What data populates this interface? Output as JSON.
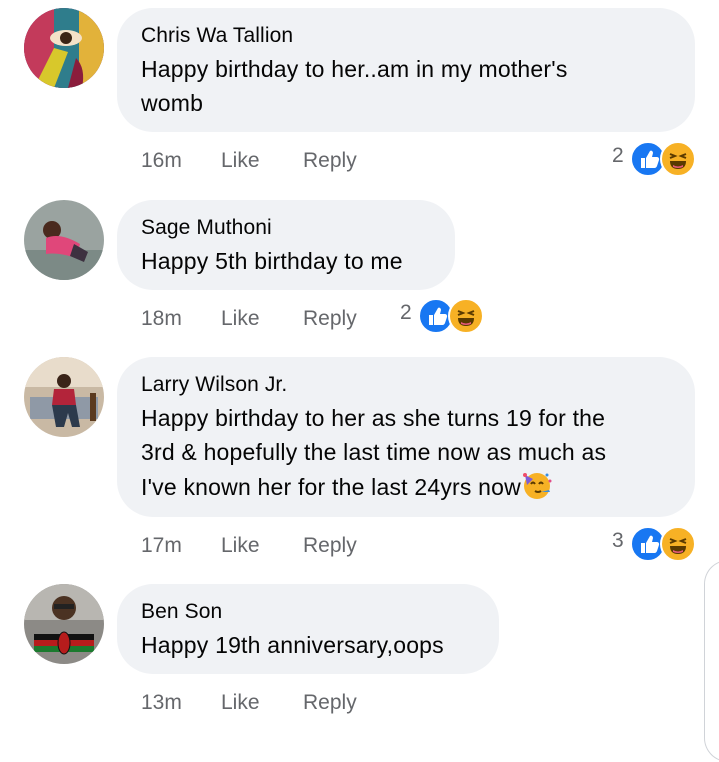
{
  "actions": {
    "like_label": "Like",
    "reply_label": "Reply"
  },
  "comments": [
    {
      "author": "Chris Wa Tallion",
      "text": "Happy birthday to her..am in my mother's womb",
      "text_lines": [
        "Happy birthday to her..am in my mother's",
        "womb"
      ],
      "time": "16m",
      "reaction_count": "2",
      "reactions": [
        "like-icon",
        "haha-icon"
      ]
    },
    {
      "author": "Sage Muthoni",
      "text": "Happy 5th birthday to me",
      "time": "18m",
      "reaction_count": "2",
      "reactions": [
        "like-icon",
        "haha-icon"
      ]
    },
    {
      "author": "Larry Wilson Jr.",
      "text_lines": [
        "Happy birthday to her as she turns 19 for the",
        "3rd & hopefully the last time now as much as",
        "I've known her for the last 24yrs now"
      ],
      "trailing_emoji": "partying-face-emoji",
      "time": "17m",
      "reaction_count": "3",
      "reactions": [
        "like-icon",
        "haha-icon"
      ]
    },
    {
      "author": "Ben Son",
      "text": "Happy 19th anniversary,oops",
      "time": "13m"
    }
  ],
  "colors": {
    "bubble": "#f0f2f5",
    "meta_text": "#65676b",
    "like_blue": "#1877f2",
    "haha_yellow": "#f7b125"
  }
}
